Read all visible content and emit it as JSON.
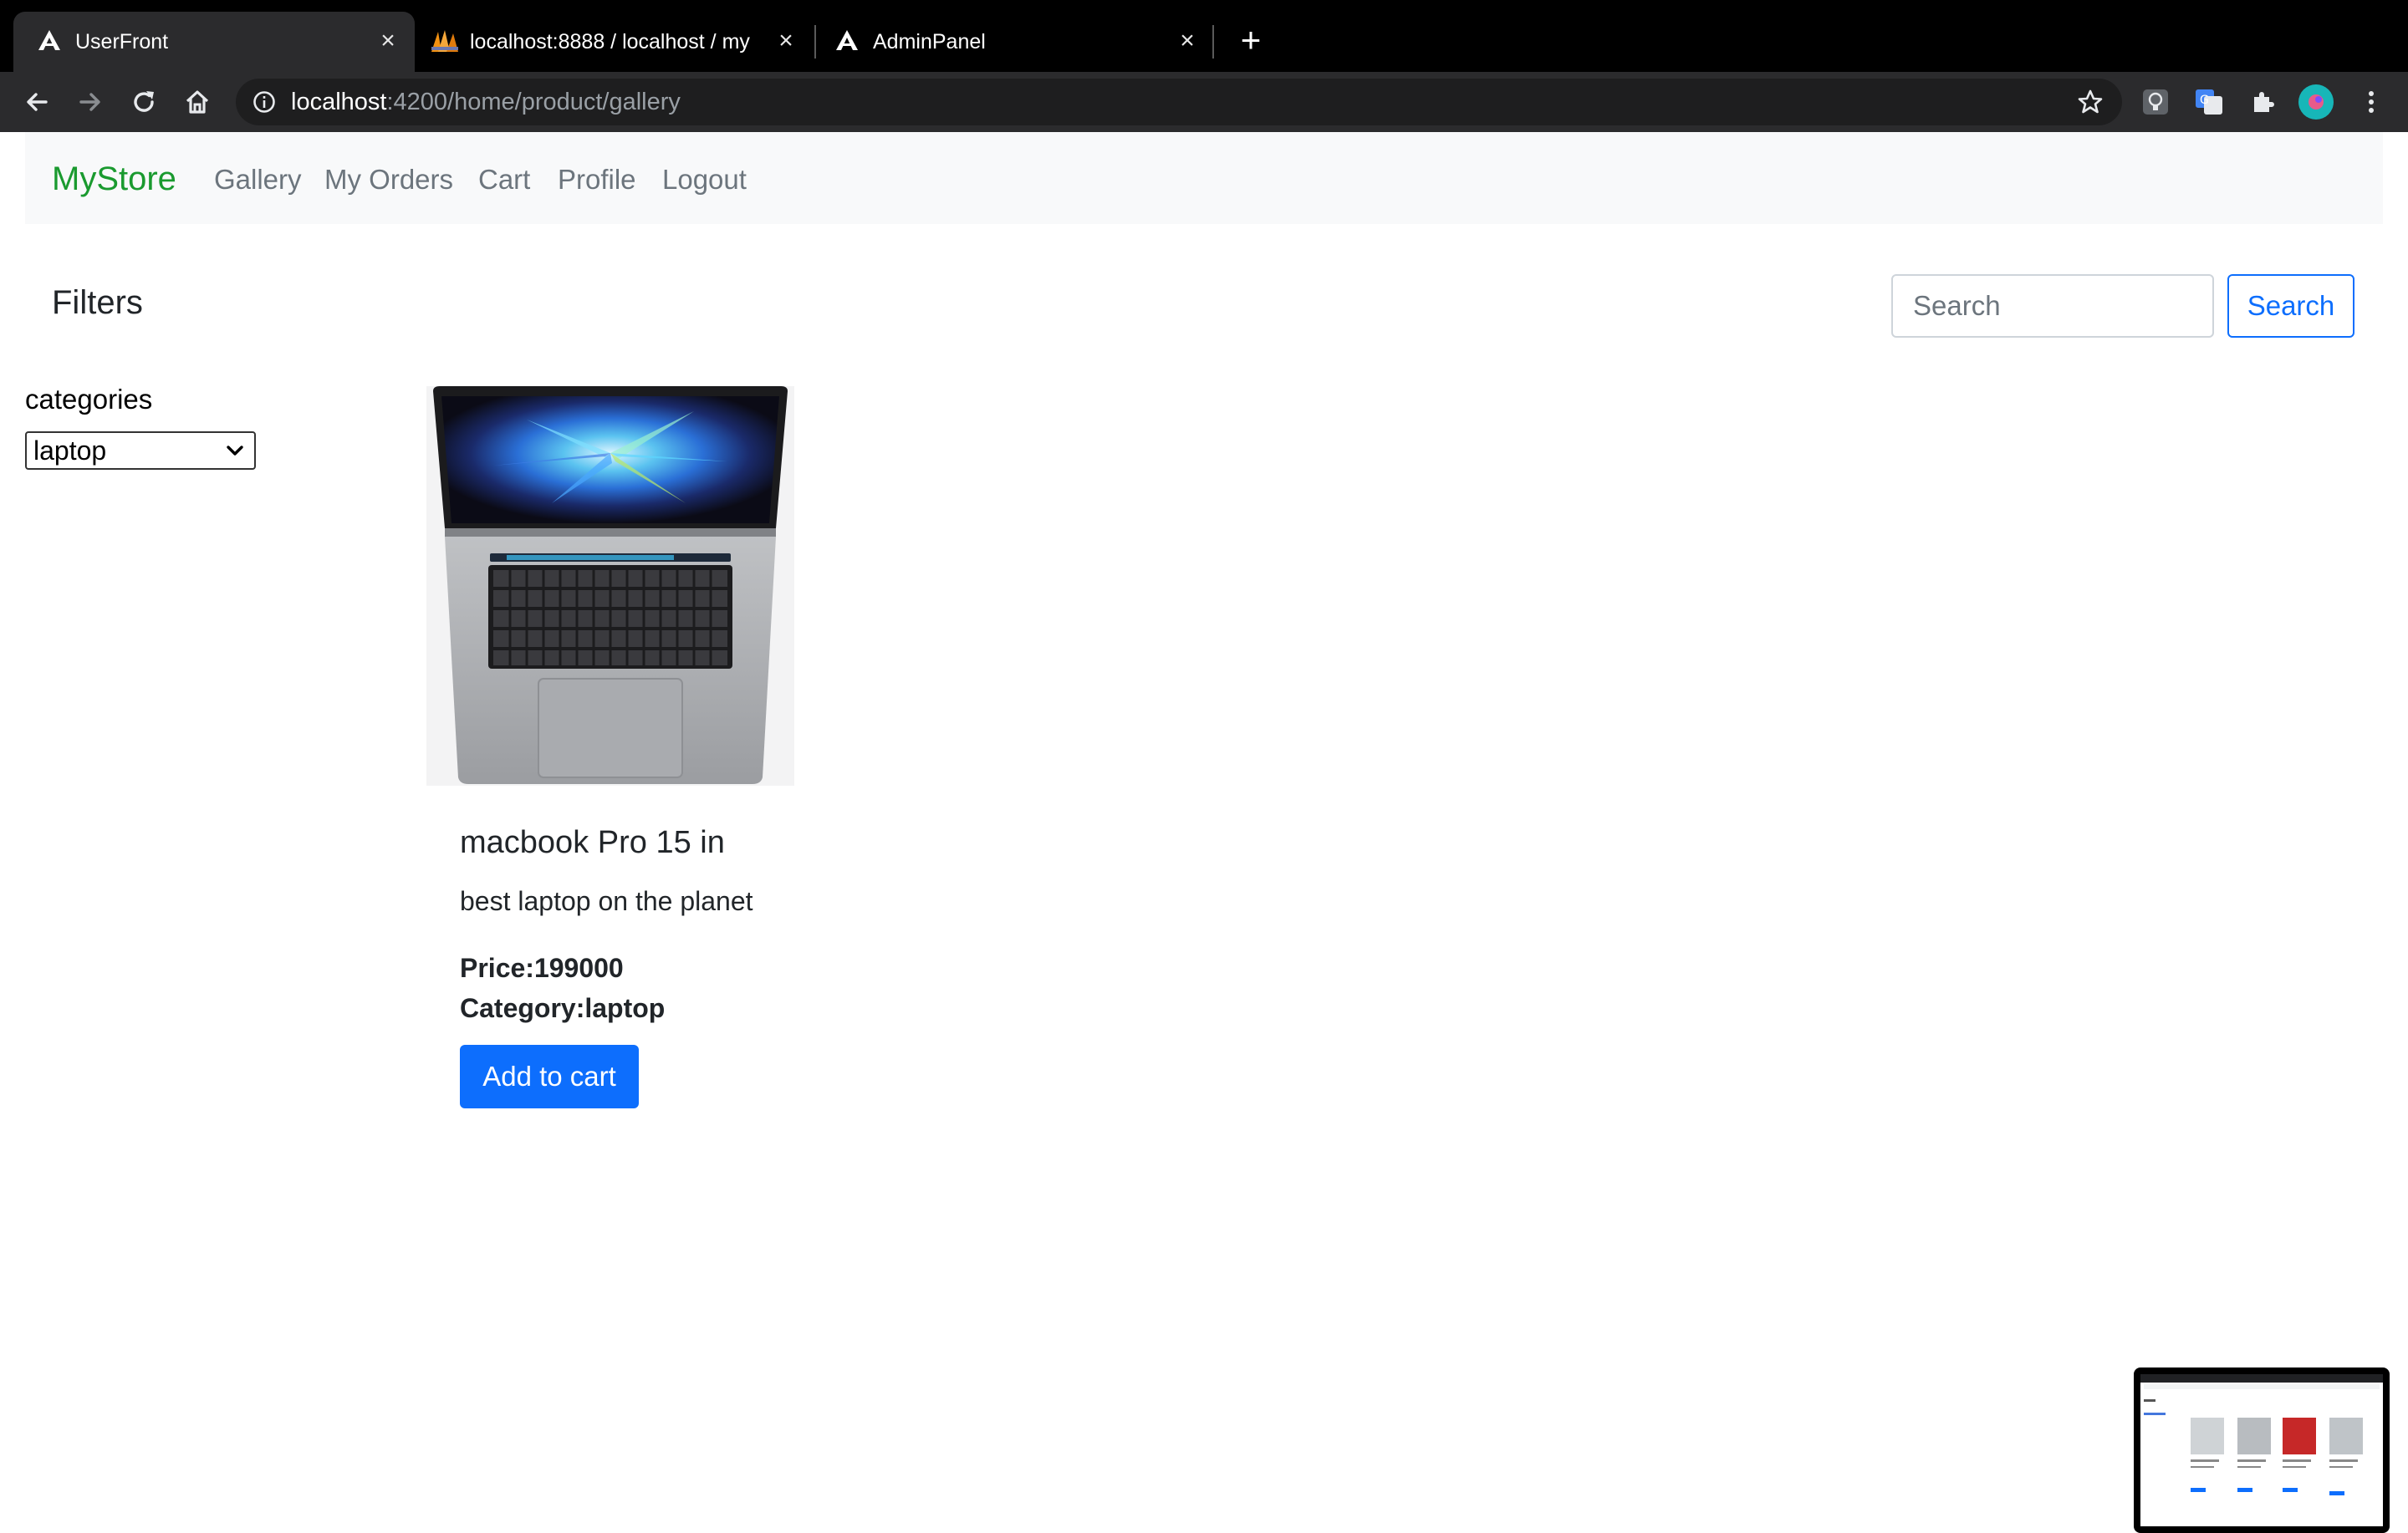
{
  "browser": {
    "tabs": [
      {
        "title": "UserFront",
        "active": true
      },
      {
        "title": "localhost:8888 / localhost / my",
        "active": false
      },
      {
        "title": "AdminPanel",
        "active": false
      }
    ],
    "url_host": "localhost",
    "url_path": ":4200/home/product/gallery"
  },
  "navbar": {
    "brand": "MyStore",
    "links": [
      "Gallery",
      "My Orders",
      "Cart",
      "Profile",
      "Logout"
    ]
  },
  "filters": {
    "heading": "Filters",
    "categories_label": "categories",
    "selected_category": "laptop"
  },
  "search": {
    "placeholder": "Search",
    "button_label": "Search"
  },
  "product": {
    "title": "macbook Pro 15 in",
    "description": "best laptop on the planet",
    "price_text": "Price:199000",
    "category_text": "Category:laptop",
    "add_to_cart_label": "Add to cart"
  },
  "colors": {
    "brand": "#1a9a2f",
    "primary": "#0d6efd",
    "navbar_bg": "#f8f9fa"
  }
}
